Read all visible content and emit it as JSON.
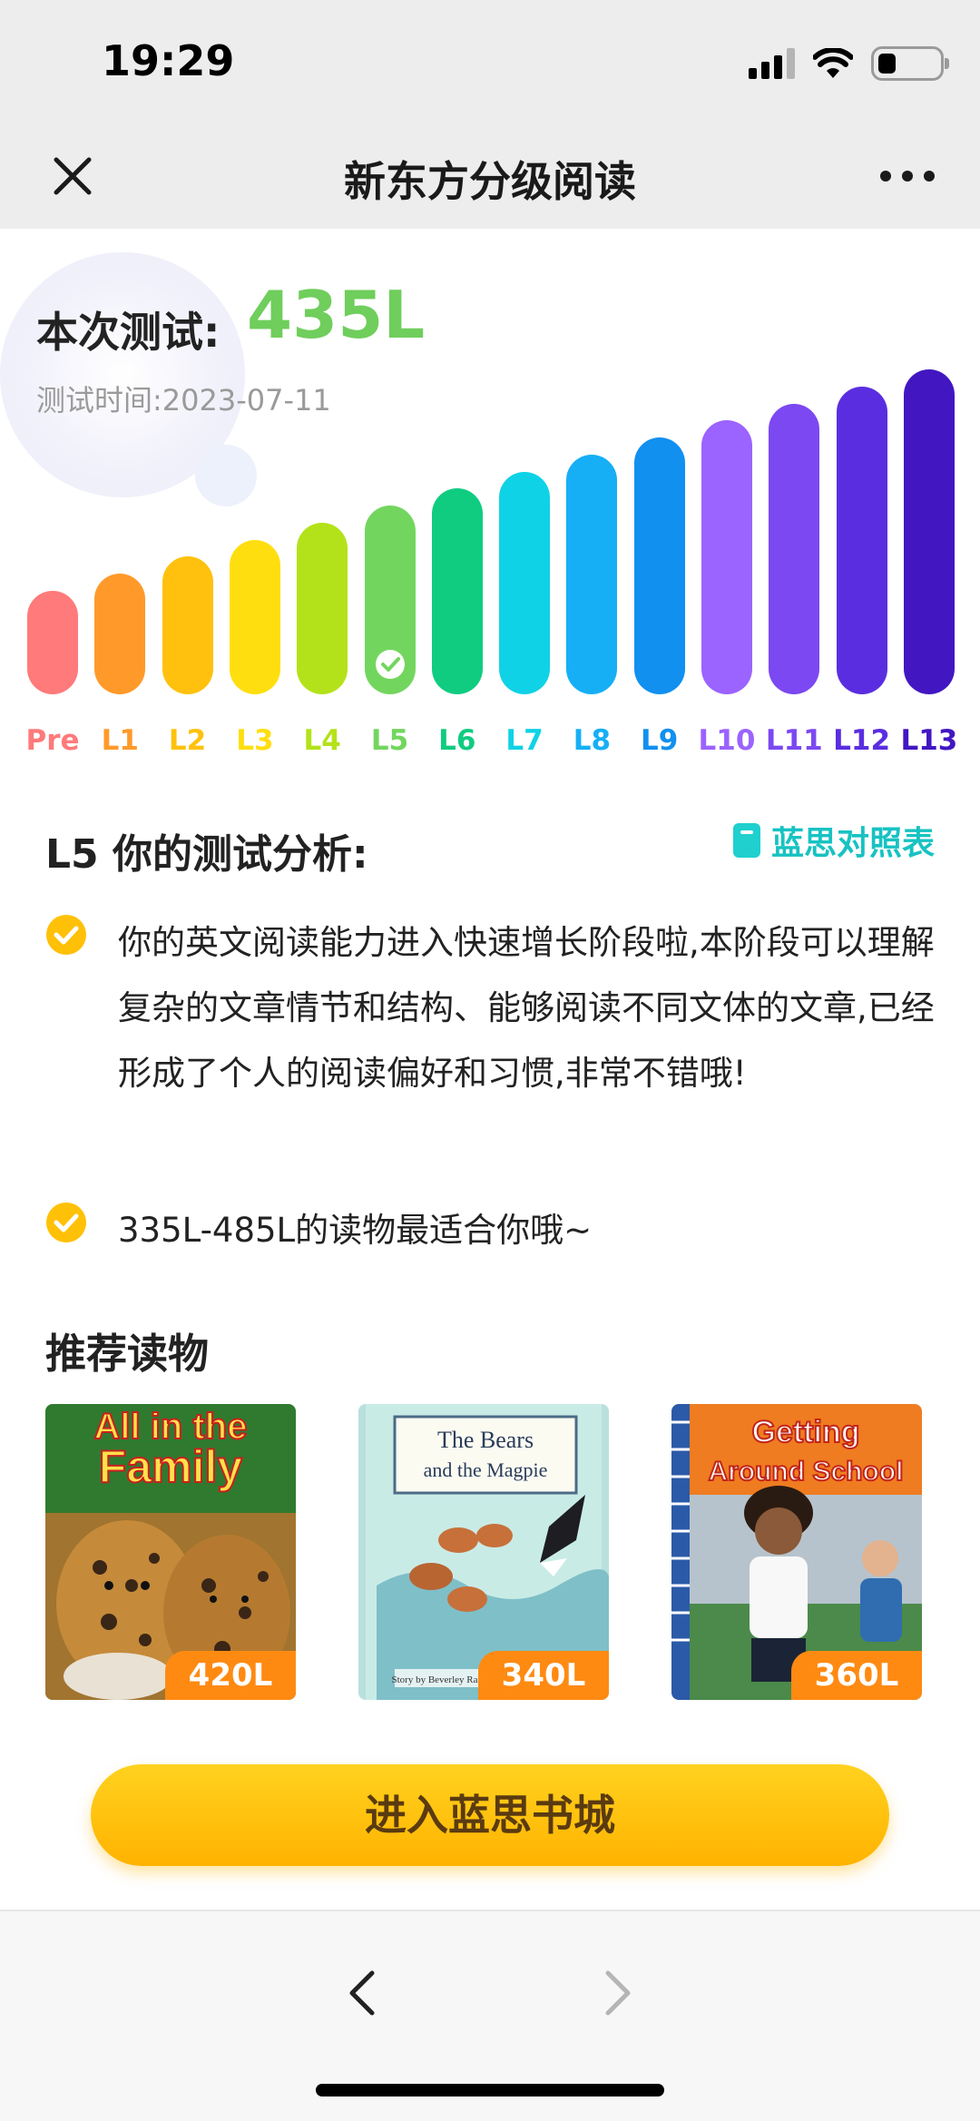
{
  "status_bar": {
    "time": "19:29",
    "battery_level": 0.3
  },
  "nav": {
    "title": "新东方分级阅读",
    "close_icon": "close-icon",
    "more_icon": "more-icon"
  },
  "score": {
    "label": "本次测试:",
    "value": "435L",
    "date": "测试时间:2023-07-11",
    "value_color": "#6fce5c"
  },
  "levels": {
    "current": "L5",
    "items": [
      {
        "label": "Pre",
        "color": "#ff7a7a",
        "active": false
      },
      {
        "label": "L1",
        "color": "#ff9a2a",
        "active": false
      },
      {
        "label": "L2",
        "color": "#ffc10e",
        "active": false
      },
      {
        "label": "L3",
        "color": "#ffde10",
        "active": false
      },
      {
        "label": "L4",
        "color": "#b4e21a",
        "active": false
      },
      {
        "label": "L5",
        "color": "#72d65e",
        "active": true
      },
      {
        "label": "L6",
        "color": "#10cc80",
        "active": false
      },
      {
        "label": "L7",
        "color": "#10d2e6",
        "active": false
      },
      {
        "label": "L8",
        "color": "#16aff6",
        "active": false
      },
      {
        "label": "L9",
        "color": "#1190f0",
        "active": false
      },
      {
        "label": "L10",
        "color": "#9b63ff",
        "active": false
      },
      {
        "label": "L11",
        "color": "#7c48f2",
        "active": false
      },
      {
        "label": "L12",
        "color": "#5a2ee0",
        "active": false
      },
      {
        "label": "L13",
        "color": "#4217c2",
        "active": false
      }
    ]
  },
  "analysis": {
    "title": "L5 你的测试分析:",
    "link_label": "蓝思对照表",
    "bullets": [
      "你的英文阅读能力进入快速增长阶段啦,本阶段可以理解复杂的文章情节和结构、能够阅读不同文体的文章,已经形成了个人的阅读偏好和习惯,非常不错哦!",
      "335L-485L的读物最适合你哦~"
    ]
  },
  "recommended": {
    "title": "推荐读物",
    "books": [
      {
        "cover_title_1": "All in the",
        "cover_title_2": "Family",
        "level": "420L"
      },
      {
        "cover_title_1": "The Bears",
        "cover_title_2": "and the Magpie",
        "cover_author": "Story by Beverley Randell",
        "level": "340L"
      },
      {
        "cover_title_1": "Getting",
        "cover_title_2": "Around School",
        "level": "360L"
      }
    ]
  },
  "cta": {
    "label": "进入蓝思书城"
  },
  "bottom_nav": {
    "back_icon": "back-icon",
    "forward_icon": "forward-icon"
  }
}
